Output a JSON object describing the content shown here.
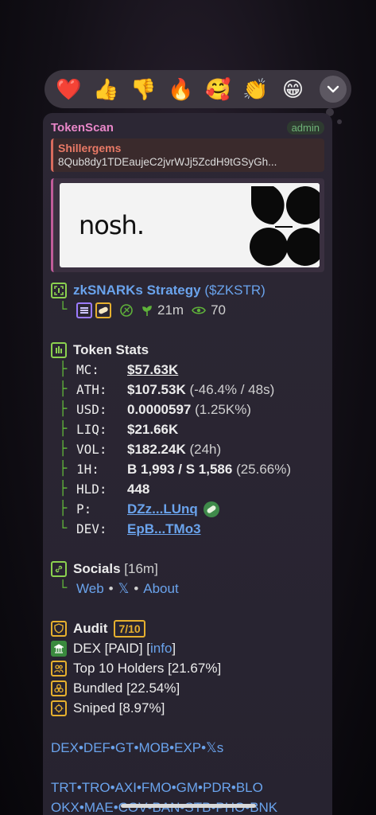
{
  "reactions": [
    "❤️",
    "👍",
    "👎",
    "🔥",
    "🥰",
    "👏",
    "😁"
  ],
  "message": {
    "sender": "TokenScan",
    "role_badge": "admin",
    "reply": {
      "name": "Shillergems",
      "text": "8Qub8dy1TDEaujeC2jvrWJj5ZcdH9tGSyGh..."
    },
    "banner_text": "nosh."
  },
  "token": {
    "name": "zkSNARKs Strategy",
    "symbol": "($ZKSTR)",
    "age": "21m",
    "views": "70"
  },
  "stats": {
    "heading": "Token Stats",
    "rows": [
      {
        "label": "MC:",
        "value": "$57.63K",
        "extra": ""
      },
      {
        "label": "ATH:",
        "value": "$107.53K",
        "extra": "(-46.4% / 48s)"
      },
      {
        "label": "USD:",
        "value": "0.0000597",
        "extra": "(1.25K%)"
      },
      {
        "label": "LIQ:",
        "value": "$21.66K",
        "extra": ""
      },
      {
        "label": "VOL:",
        "value": "$182.24K",
        "extra": "(24h)"
      },
      {
        "label": "1H:",
        "value": "B 1,993 / S 1,586",
        "extra": "(25.66%)"
      },
      {
        "label": "HLD:",
        "value": "448",
        "extra": ""
      },
      {
        "label": "P:",
        "value": "DZz...LUnq",
        "extra": ""
      },
      {
        "label": "DEV:",
        "value": "EpB...TMo3",
        "extra": ""
      }
    ]
  },
  "socials": {
    "heading": "Socials",
    "age": "[16m]",
    "links": [
      "Web",
      "𝕏",
      "About"
    ]
  },
  "audit": {
    "heading": "Audit",
    "score": "7/10",
    "dex": "DEX [PAID] [",
    "dex_link": "info",
    "dex_close": "]",
    "top10": "Top 10 Holders [21.67%]",
    "bundled": "Bundled [22.54%]",
    "sniped": "Sniped [8.97%]"
  },
  "quick_links": {
    "row1": [
      "DEX",
      "DEF",
      "GT",
      "MOB",
      "EXP",
      "𝕏s"
    ],
    "row2": [
      "TRT",
      "TRO",
      "AXI",
      "FMO",
      "GM",
      "PDR",
      "BLO"
    ],
    "row3": [
      "OKX",
      "MAE",
      "COV",
      "BAN",
      "STB",
      "PHO",
      "BNK"
    ]
  },
  "colors": {
    "accent_green": "#8bd14f",
    "link_blue": "#6aa3ec",
    "gold": "#e6b02e",
    "sender_pink": "#e987c9"
  }
}
